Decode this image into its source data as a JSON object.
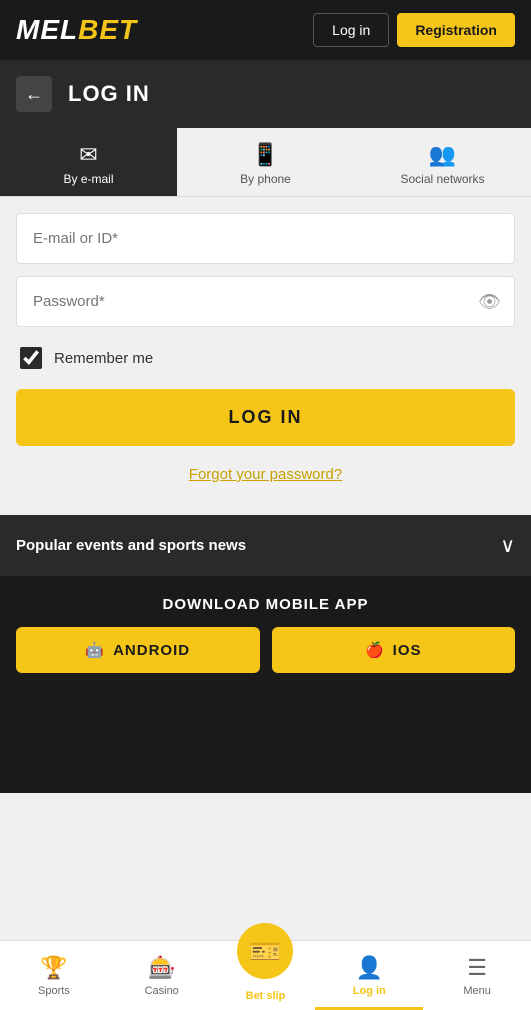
{
  "header": {
    "logo_mel": "MEL",
    "logo_bet": "BET",
    "login_label": "Log in",
    "register_label": "Registration"
  },
  "page_title_bar": {
    "back_icon": "←",
    "title": "LOG IN"
  },
  "tabs": [
    {
      "id": "email",
      "label": "By e-mail",
      "icon": "✉",
      "active": true
    },
    {
      "id": "phone",
      "label": "By phone",
      "icon": "📱",
      "active": false
    },
    {
      "id": "social",
      "label": "Social networks",
      "icon": "👥",
      "active": false
    }
  ],
  "form": {
    "email_placeholder": "E-mail or ID*",
    "password_placeholder": "Password*",
    "remember_label": "Remember me",
    "login_button": "LOG IN",
    "forgot_password": "Forgot your password?"
  },
  "popular_section": {
    "label": "Popular events and sports news",
    "chevron": "∨"
  },
  "download_section": {
    "title": "DOWNLOAD MOBILE APP",
    "android_label": "ANDROID",
    "ios_label": "IOS"
  },
  "bottom_nav": [
    {
      "id": "sports",
      "label": "Sports",
      "icon": "🏆",
      "active": false
    },
    {
      "id": "casino",
      "label": "Casino",
      "icon": "🎰",
      "active": false
    },
    {
      "id": "betslip",
      "label": "Bet slip",
      "icon": "🎫",
      "active": true,
      "center": true
    },
    {
      "id": "login",
      "label": "Log in",
      "icon": "👤",
      "active": true
    },
    {
      "id": "menu",
      "label": "Menu",
      "icon": "☰",
      "active": false
    }
  ]
}
